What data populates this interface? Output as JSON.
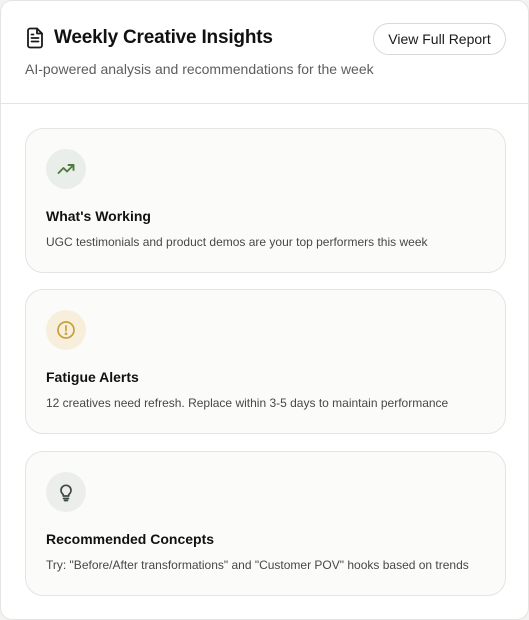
{
  "header": {
    "title": "Weekly Creative Insights",
    "subtitle": "AI-powered analysis and recommendations for the week",
    "report_button": "View Full Report",
    "icon": "document-icon"
  },
  "insights": [
    {
      "icon": "trending-up-icon",
      "icon_color": "#4f7a3f",
      "title": "What's Working",
      "description": "UGC testimonials and product demos are your top performers this week"
    },
    {
      "icon": "alert-circle-icon",
      "icon_color": "#c9a03a",
      "title": "Fatigue Alerts",
      "description": "12 creatives need refresh. Replace within 3-5 days to maintain performance"
    },
    {
      "icon": "lightbulb-icon",
      "icon_color": "#3d4a40",
      "title": "Recommended Concepts",
      "description": "Try: \"Before/After transformations\" and \"Customer POV\" hooks based on trends"
    }
  ]
}
